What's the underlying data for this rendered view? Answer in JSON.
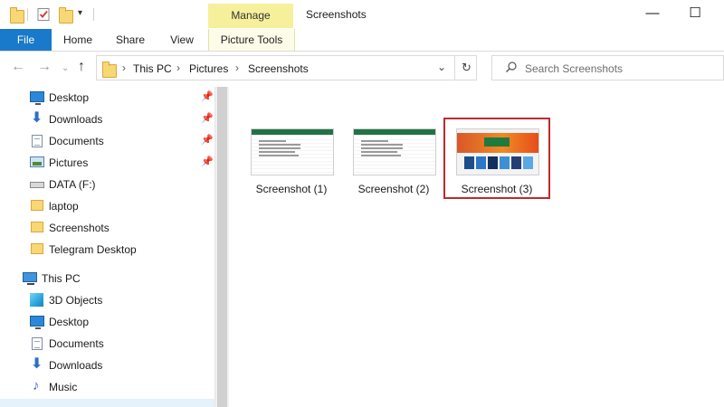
{
  "window": {
    "title": "Screenshots",
    "manage_label": "Manage",
    "minimize_glyph": "—",
    "maximize_glyph": "☐"
  },
  "ribbon": {
    "tabs": [
      {
        "label": "File"
      },
      {
        "label": "Home"
      },
      {
        "label": "Share"
      },
      {
        "label": "View"
      },
      {
        "label": "Picture Tools"
      }
    ]
  },
  "address": {
    "breadcrumbs": [
      "This PC",
      "Pictures",
      "Screenshots"
    ],
    "separator": "›"
  },
  "search": {
    "placeholder": "Search Screenshots"
  },
  "sidebar": {
    "quick_access": [
      {
        "label": "Desktop",
        "icon": "desktop-icon",
        "pinned": true
      },
      {
        "label": "Downloads",
        "icon": "downloads-icon",
        "pinned": true
      },
      {
        "label": "Documents",
        "icon": "documents-icon",
        "pinned": true
      },
      {
        "label": "Pictures",
        "icon": "pictures-icon",
        "pinned": true
      },
      {
        "label": "DATA (F:)",
        "icon": "drive-icon",
        "pinned": false
      },
      {
        "label": "laptop",
        "icon": "folder-icon",
        "pinned": false
      },
      {
        "label": "Screenshots",
        "icon": "folder-icon",
        "pinned": false
      },
      {
        "label": "Telegram Desktop",
        "icon": "folder-icon",
        "pinned": false
      }
    ],
    "this_pc_label": "This PC",
    "this_pc": [
      {
        "label": "3D Objects",
        "icon": "3d-objects-icon"
      },
      {
        "label": "Desktop",
        "icon": "desktop-icon"
      },
      {
        "label": "Documents",
        "icon": "documents-icon"
      },
      {
        "label": "Downloads",
        "icon": "downloads-icon"
      },
      {
        "label": "Music",
        "icon": "music-icon"
      }
    ]
  },
  "files": [
    {
      "name": "Screenshot (1)",
      "thumbnail": "spreadsheet",
      "selected": false
    },
    {
      "name": "Screenshot (2)",
      "thumbnail": "spreadsheet",
      "selected": false
    },
    {
      "name": "Screenshot (3)",
      "thumbnail": "webpage",
      "selected": true
    }
  ],
  "colors": {
    "file_tab": "#1979ca",
    "manage_tab": "#f6f09c",
    "selection_outline": "#c0292d"
  }
}
